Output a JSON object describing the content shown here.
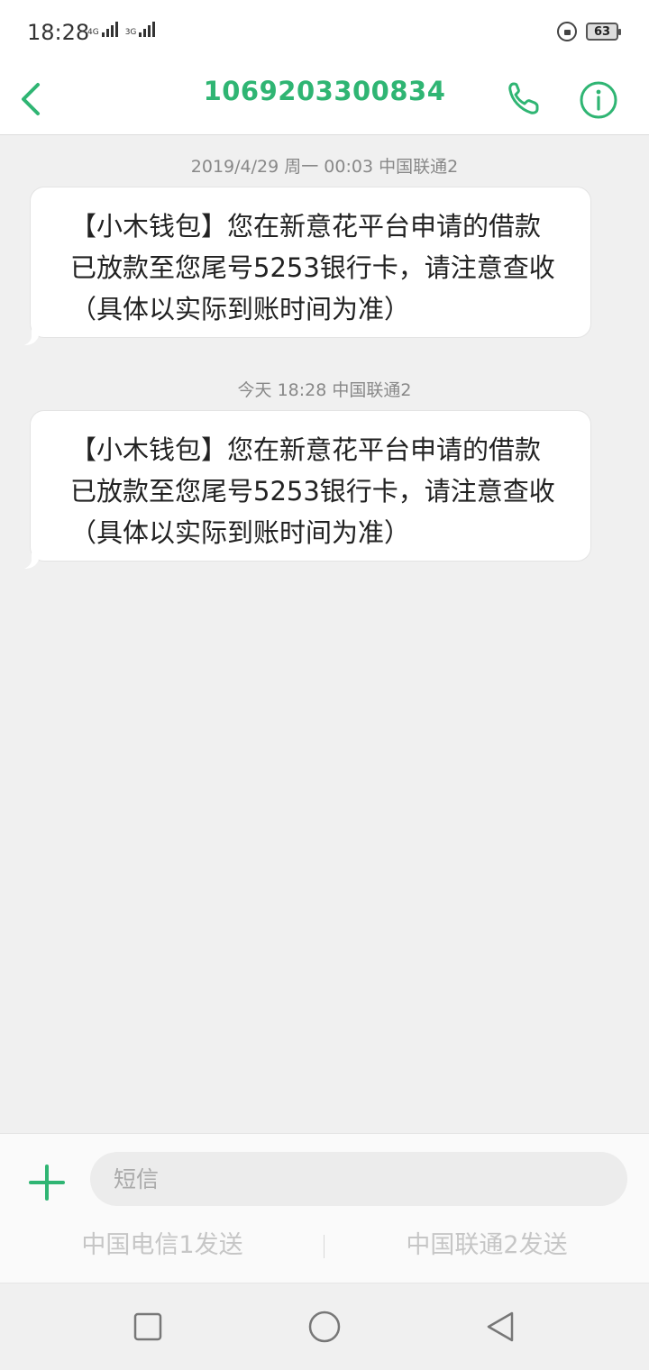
{
  "status_bar": {
    "time": "18:28",
    "signal1_label": "4G",
    "signal2_label": "3G",
    "battery": "63"
  },
  "header": {
    "title": "1069203300834",
    "accent_color": "#2fb573"
  },
  "messages": [
    {
      "time": "2019/4/29 周一 00:03  中国联通2",
      "text": "【小木钱包】您在新意花平台申请的借款已放款至您尾号5253银行卡，请注意查收（具体以实际到账时间为准）"
    },
    {
      "time": "今天 18:28  中国联通2",
      "text": "【小木钱包】您在新意花平台申请的借款已放款至您尾号5253银行卡，请注意查收（具体以实际到账时间为准）"
    }
  ],
  "composer": {
    "placeholder": "短信",
    "send_sim1": "中国电信1发送",
    "send_sim2": "中国联通2发送"
  },
  "icons": {
    "back": "back-arrow-icon",
    "call": "phone-icon",
    "info": "info-icon",
    "add": "plus-icon",
    "nav_recent": "square-icon",
    "nav_home": "circle-icon",
    "nav_back": "triangle-back-icon"
  }
}
